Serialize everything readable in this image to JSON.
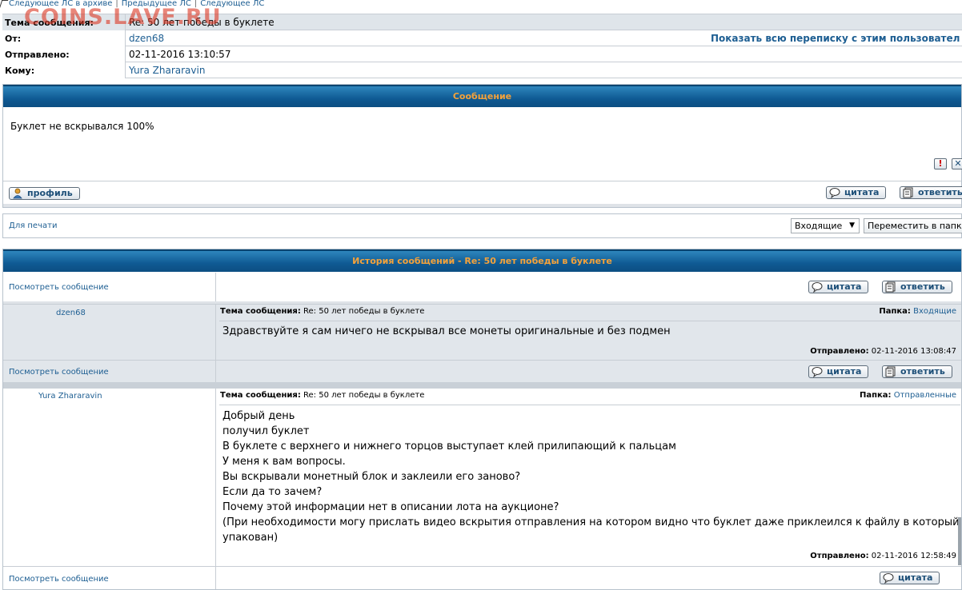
{
  "watermark": "COINS.LAVE.RU",
  "topnav": {
    "items": [
      "Следующее ЛС в архиве",
      "Предыдущее ЛС",
      "Следующее ЛС"
    ],
    "separator": "|"
  },
  "header": {
    "subject_label": "Тема сообщения:",
    "subject_value": "Re: 50 лет победы в буклете",
    "from_label": "От:",
    "from_value": "dzen68",
    "show_all_link": "Показать всю переписку с этим пользовател",
    "sent_label": "Отправлено:",
    "sent_value": "02-11-2016 13:10:57",
    "to_label": "Кому:",
    "to_value": "Yura Zhararavin"
  },
  "message": {
    "title": "Сообщение",
    "body": "Буклет не вскрывался 100%",
    "report_glyph": "!",
    "delete_glyph": "✕",
    "profile_btn": "профиль",
    "quote_btn": "цитата",
    "reply_btn": "ответить"
  },
  "actions": {
    "print_link": "Для печати",
    "folder_select": "Входящие",
    "move_btn": "Переместить в папку"
  },
  "history": {
    "title": "История сообщений - Re: 50 лет победы в буклете",
    "view_link": "Посмотреть сообщение",
    "quote_btn": "цитата",
    "reply_btn": "ответить",
    "subject_label": "Тема сообщения:",
    "folder_label": "Папка:",
    "sent_label": "Отправлено:",
    "posts": [
      {
        "author": "dzen68",
        "subject": "Re: 50 лет победы в буклете",
        "folder": "Входящие",
        "lines": [
          "Здравствуйте я сам ничего не вскрывал все монеты оригинальные и без подмен"
        ],
        "sent": "02-11-2016 13:08:47"
      },
      {
        "author": "Yura Zhararavin",
        "subject": "Re: 50 лет победы в буклете",
        "folder": "Отправленные",
        "lines": [
          "Добрый день",
          "получил буклет",
          "В буклете с верхнего и нижнего торцов выступает клей прилипающий к пальцам",
          "У меня к вам вопросы.",
          "Вы вскрывали монетный блок и заклеили его заново?",
          "Если да то зачем?",
          "Почему этой информации нет в описании лота на аукционе?",
          "(При необходимости могу прислать видео вскрытия отправления на котором видно что буклет даже приклеился к файлу в который был",
          "упакован)"
        ],
        "sent": "02-11-2016 12:58:49"
      }
    ]
  }
}
